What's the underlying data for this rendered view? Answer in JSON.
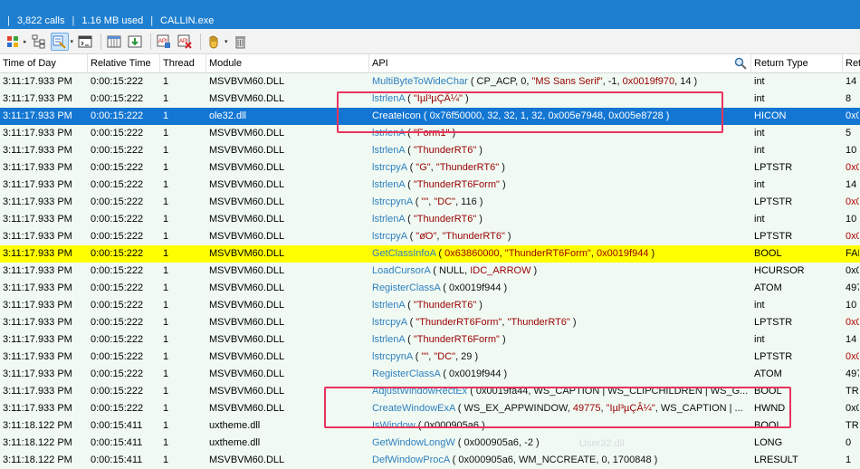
{
  "status": {
    "calls": "3,822 calls",
    "memory": "1.16 MB used",
    "process": "CALLIN.exe"
  },
  "toolbar": {
    "buttons": [
      "colors-icon",
      "tree-icon",
      "filter-icon",
      "console-icon",
      "columns-icon",
      "download-icon",
      "api-open-icon",
      "api-close-icon",
      "hand-icon",
      "delete-icon"
    ]
  },
  "columns": [
    "Time of Day",
    "Relative Time",
    "Thread",
    "Module",
    "API",
    "Return Type",
    "Ret"
  ],
  "rows": [
    {
      "time": "3:11:17.933 PM",
      "rel": "0:00:15:222",
      "thr": "1",
      "mod": "MSVBVM60.DLL",
      "api": [
        [
          "fn",
          "MultiByteToWideChar"
        ],
        [
          "pl",
          " ( CP_ACP, 0, "
        ],
        [
          "str",
          "\"MS Sans Serif\""
        ],
        [
          "pl",
          ", -1, "
        ],
        [
          "num",
          "0x0019f970"
        ],
        [
          "pl",
          ", 14 )"
        ]
      ],
      "ret": "int",
      "retv": "14"
    },
    {
      "time": "3:11:17.933 PM",
      "rel": "0:00:15:222",
      "thr": "1",
      "mod": "MSVBVM60.DLL",
      "api": [
        [
          "fn",
          "lstrlenA"
        ],
        [
          "pl",
          " ( "
        ],
        [
          "str",
          "\"Iµl³µÇÂ¼\""
        ],
        [
          "pl",
          " )"
        ]
      ],
      "ret": "int",
      "retv": "8"
    },
    {
      "time": "3:11:17.933 PM",
      "rel": "0:00:15:222",
      "thr": "1",
      "mod": "ole32.dll",
      "api": [
        [
          "fn",
          "CreateIcon"
        ],
        [
          "pl",
          " ( 0x76f50000, 32, 32, 1, 32, 0x005e7948, 0x005e8728 )"
        ]
      ],
      "ret": "HICON",
      "retv": "0x0",
      "selected": true
    },
    {
      "time": "3:11:17.933 PM",
      "rel": "0:00:15:222",
      "thr": "1",
      "mod": "MSVBVM60.DLL",
      "api": [
        [
          "fn",
          "lstrlenA"
        ],
        [
          "pl",
          " ( "
        ],
        [
          "str",
          "\"Form1\""
        ],
        [
          "pl",
          " )"
        ]
      ],
      "ret": "int",
      "retv": "5"
    },
    {
      "time": "3:11:17.933 PM",
      "rel": "0:00:15:222",
      "thr": "1",
      "mod": "MSVBVM60.DLL",
      "api": [
        [
          "fn",
          "lstrlenA"
        ],
        [
          "pl",
          " ( "
        ],
        [
          "str",
          "\"ThunderRT6\""
        ],
        [
          "pl",
          " )"
        ]
      ],
      "ret": "int",
      "retv": "10"
    },
    {
      "time": "3:11:17.933 PM",
      "rel": "0:00:15:222",
      "thr": "1",
      "mod": "MSVBVM60.DLL",
      "api": [
        [
          "fn",
          "lstrcpyA"
        ],
        [
          "pl",
          " ( "
        ],
        [
          "str",
          "\"G\""
        ],
        [
          "pl",
          ", "
        ],
        [
          "str",
          "\"ThunderRT6\""
        ],
        [
          "pl",
          " )"
        ]
      ],
      "ret": "LPTSTR",
      "retv": "0x0",
      "retverr": true
    },
    {
      "time": "3:11:17.933 PM",
      "rel": "0:00:15:222",
      "thr": "1",
      "mod": "MSVBVM60.DLL",
      "api": [
        [
          "fn",
          "lstrlenA"
        ],
        [
          "pl",
          " ( "
        ],
        [
          "str",
          "\"ThunderRT6Form\""
        ],
        [
          "pl",
          " )"
        ]
      ],
      "ret": "int",
      "retv": "14"
    },
    {
      "time": "3:11:17.933 PM",
      "rel": "0:00:15:222",
      "thr": "1",
      "mod": "MSVBVM60.DLL",
      "api": [
        [
          "fn",
          "lstrcpynA"
        ],
        [
          "pl",
          " ( "
        ],
        [
          "str",
          "\"\""
        ],
        [
          "pl",
          ", "
        ],
        [
          "str",
          "\"DC\""
        ],
        [
          "pl",
          ", 116 )"
        ]
      ],
      "ret": "LPTSTR",
      "retv": "0x0",
      "retverr": true
    },
    {
      "time": "3:11:17.933 PM",
      "rel": "0:00:15:222",
      "thr": "1",
      "mod": "MSVBVM60.DLL",
      "api": [
        [
          "fn",
          "lstrlenA"
        ],
        [
          "pl",
          " ( "
        ],
        [
          "str",
          "\"ThunderRT6\""
        ],
        [
          "pl",
          " )"
        ]
      ],
      "ret": "int",
      "retv": "10"
    },
    {
      "time": "3:11:17.933 PM",
      "rel": "0:00:15:222",
      "thr": "1",
      "mod": "MSVBVM60.DLL",
      "api": [
        [
          "fn",
          "lstrcpyA"
        ],
        [
          "pl",
          " ( "
        ],
        [
          "str",
          "\"øΌ\""
        ],
        [
          "pl",
          ", "
        ],
        [
          "str",
          "\"ThunderRT6\""
        ],
        [
          "pl",
          " )"
        ]
      ],
      "ret": "LPTSTR",
      "retv": "0x0",
      "retverr": true
    },
    {
      "time": "3:11:17.933 PM",
      "rel": "0:00:15:222",
      "thr": "1",
      "mod": "MSVBVM60.DLL",
      "api": [
        [
          "fn",
          "GetClassInfoA"
        ],
        [
          "pl",
          " ( "
        ],
        [
          "num",
          "0x63860000"
        ],
        [
          "pl",
          ", "
        ],
        [
          "str",
          "\"ThunderRT6Form\""
        ],
        [
          "pl",
          ", "
        ],
        [
          "num",
          "0x0019f944"
        ],
        [
          "pl",
          " )"
        ]
      ],
      "ret": "BOOL",
      "retv": "FAL",
      "highlight": true
    },
    {
      "time": "3:11:17.933 PM",
      "rel": "0:00:15:222",
      "thr": "1",
      "mod": "MSVBVM60.DLL",
      "api": [
        [
          "fn",
          "LoadCursorA"
        ],
        [
          "pl",
          " ( NULL, "
        ],
        [
          "str",
          "IDC_ARROW"
        ],
        [
          "pl",
          " )"
        ]
      ],
      "ret": "HCURSOR",
      "retv": "0x0"
    },
    {
      "time": "3:11:17.933 PM",
      "rel": "0:00:15:222",
      "thr": "1",
      "mod": "MSVBVM60.DLL",
      "api": [
        [
          "fn",
          "RegisterClassA"
        ],
        [
          "pl",
          " ( 0x0019f944 )"
        ]
      ],
      "ret": "ATOM",
      "retv": "497"
    },
    {
      "time": "3:11:17.933 PM",
      "rel": "0:00:15:222",
      "thr": "1",
      "mod": "MSVBVM60.DLL",
      "api": [
        [
          "fn",
          "lstrlenA"
        ],
        [
          "pl",
          " ( "
        ],
        [
          "str",
          "\"ThunderRT6\""
        ],
        [
          "pl",
          " )"
        ]
      ],
      "ret": "int",
      "retv": "10"
    },
    {
      "time": "3:11:17.933 PM",
      "rel": "0:00:15:222",
      "thr": "1",
      "mod": "MSVBVM60.DLL",
      "api": [
        [
          "fn",
          "lstrcpyA"
        ],
        [
          "pl",
          " ( "
        ],
        [
          "str",
          "\"ThunderRT6Form\""
        ],
        [
          "pl",
          ", "
        ],
        [
          "str",
          "\"ThunderRT6\""
        ],
        [
          "pl",
          " )"
        ]
      ],
      "ret": "LPTSTR",
      "retv": "0x0",
      "retverr": true
    },
    {
      "time": "3:11:17.933 PM",
      "rel": "0:00:15:222",
      "thr": "1",
      "mod": "MSVBVM60.DLL",
      "api": [
        [
          "fn",
          "lstrlenA"
        ],
        [
          "pl",
          " ( "
        ],
        [
          "str",
          "\"ThunderRT6Form\""
        ],
        [
          "pl",
          " )"
        ]
      ],
      "ret": "int",
      "retv": "14"
    },
    {
      "time": "3:11:17.933 PM",
      "rel": "0:00:15:222",
      "thr": "1",
      "mod": "MSVBVM60.DLL",
      "api": [
        [
          "fn",
          "lstrcpynA"
        ],
        [
          "pl",
          " ( "
        ],
        [
          "str",
          "\"\""
        ],
        [
          "pl",
          ", "
        ],
        [
          "str",
          "\"DC\""
        ],
        [
          "pl",
          ", 29 )"
        ]
      ],
      "ret": "LPTSTR",
      "retv": "0x0",
      "retverr": true
    },
    {
      "time": "3:11:17.933 PM",
      "rel": "0:00:15:222",
      "thr": "1",
      "mod": "MSVBVM60.DLL",
      "api": [
        [
          "fn",
          "RegisterClassA"
        ],
        [
          "pl",
          " ( 0x0019f944 )"
        ]
      ],
      "ret": "ATOM",
      "retv": "497"
    },
    {
      "time": "3:11:17.933 PM",
      "rel": "0:00:15:222",
      "thr": "1",
      "mod": "MSVBVM60.DLL",
      "api": [
        [
          "fn",
          "AdjustWindowRectEx"
        ],
        [
          "pl",
          " ( 0x0019fa44, WS_CAPTION | WS_CLIPCHILDREN | WS_G..."
        ]
      ],
      "ret": "BOOL",
      "retv": "TRU"
    },
    {
      "time": "3:11:17.933 PM",
      "rel": "0:00:15:222",
      "thr": "1",
      "mod": "MSVBVM60.DLL",
      "api": [
        [
          "fn",
          "CreateWindowExA"
        ],
        [
          "pl",
          " ( WS_EX_APPWINDOW, "
        ],
        [
          "num",
          "49775"
        ],
        [
          "pl",
          ", "
        ],
        [
          "str",
          "\"Iµl³µÇÂ¼\""
        ],
        [
          "pl",
          ", WS_CAPTION | ..."
        ]
      ],
      "ret": "HWND",
      "retv": "0x0"
    },
    {
      "time": "3:11:18.122 PM",
      "rel": "0:00:15:411",
      "thr": "1",
      "mod": "uxtheme.dll",
      "api": [
        [
          "fn",
          "IsWindow"
        ],
        [
          "pl",
          " ( 0x000905a6 )"
        ]
      ],
      "ret": "BOOL",
      "retv": "TRU"
    },
    {
      "time": "3:11:18.122 PM",
      "rel": "0:00:15:411",
      "thr": "1",
      "mod": "uxtheme.dll",
      "api": [
        [
          "fn",
          "GetWindowLongW"
        ],
        [
          "pl",
          " ( 0x000905a6, -2 )"
        ]
      ],
      "ret": "LONG",
      "retv": "0"
    },
    {
      "time": "3:11:18.122 PM",
      "rel": "0:00:15:411",
      "thr": "1",
      "mod": "MSVBVM60.DLL",
      "api": [
        [
          "fn",
          "DefWindowProcA"
        ],
        [
          "pl",
          " ( 0x000905a6, WM_NCCREATE, 0, 1700848 )"
        ]
      ],
      "ret": "LRESULT",
      "retv": "1"
    }
  ],
  "ghost_text": "User32.dll",
  "colors": {
    "status_bg": "#1e7fd0",
    "selected_bg": "#1376d3",
    "highlight_bg": "#ffff00",
    "row_bg": "#f0faf3",
    "annotation_red": "#e8335d"
  }
}
